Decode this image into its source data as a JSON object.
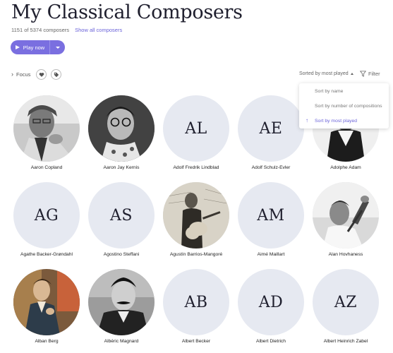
{
  "header": {
    "title": "My Classical Composers",
    "count_text": "1151 of 5374 composers",
    "show_all": "Show all composers"
  },
  "play": {
    "label": "Play now"
  },
  "toolbar": {
    "focus_label": "Focus",
    "sort_label": "Sorted by most played",
    "filter_label": "Filter"
  },
  "sort_menu": {
    "items": [
      "Sort by name",
      "Sort by number of compositions",
      "Sort by most played"
    ],
    "selected_index": 2
  },
  "colors": {
    "accent": "#7a6fe0",
    "placeholder_bg": "#e6e9f1"
  },
  "composers": [
    {
      "name": "Aaron Copland",
      "initials": "",
      "photo": "photo-bw-portrait"
    },
    {
      "name": "Aaron Jay Kernis",
      "initials": "",
      "photo": "photo-bw-glasses"
    },
    {
      "name": "Adolf Fredrik Lindblad",
      "initials": "AL",
      "photo": ""
    },
    {
      "name": "Adolf Schulz-Evler",
      "initials": "AE",
      "photo": ""
    },
    {
      "name": "Adolphe Adam",
      "initials": "",
      "photo": "photo-bw-engraving"
    },
    {
      "name": "Agathe Backer-Grøndahl",
      "initials": "AG",
      "photo": ""
    },
    {
      "name": "Agostino Steffani",
      "initials": "AS",
      "photo": ""
    },
    {
      "name": "Agustín Barrios-Mangoré",
      "initials": "",
      "photo": "photo-sepia-guitarist"
    },
    {
      "name": "Aimé Maillart",
      "initials": "AM",
      "photo": ""
    },
    {
      "name": "Alan Hovhaness",
      "initials": "",
      "photo": "photo-bw-conducting"
    },
    {
      "name": "Alban Berg",
      "initials": "",
      "photo": "photo-painted-portrait"
    },
    {
      "name": "Albéric Magnard",
      "initials": "",
      "photo": "photo-bw-mustache"
    },
    {
      "name": "Albert Becker",
      "initials": "AB",
      "photo": ""
    },
    {
      "name": "Albert Dietrich",
      "initials": "AD",
      "photo": ""
    },
    {
      "name": "Albert Heinrich Zabel",
      "initials": "AZ",
      "photo": ""
    }
  ]
}
